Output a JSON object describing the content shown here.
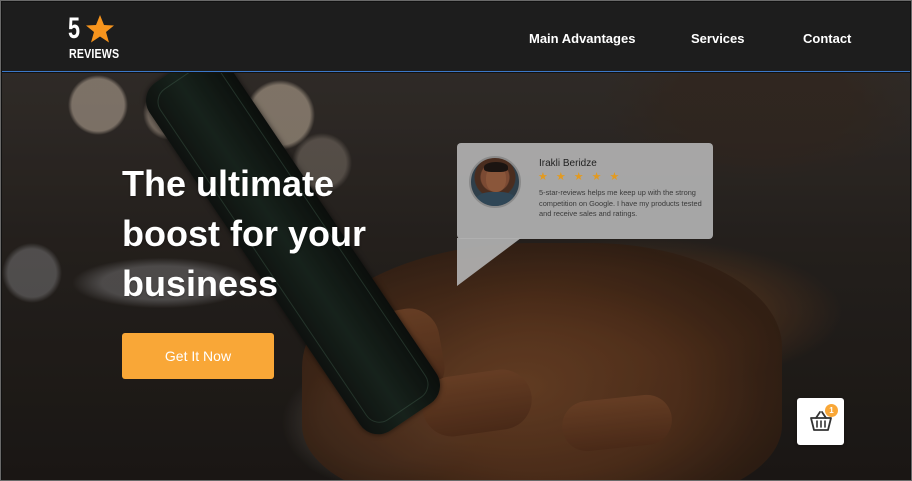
{
  "brand": {
    "logo_number": "5",
    "logo_word": "REVIEWS",
    "star_color": "#f7941d"
  },
  "nav": {
    "items": [
      {
        "label": "Main Advantages"
      },
      {
        "label": "Services"
      },
      {
        "label": "Contact"
      }
    ]
  },
  "hero": {
    "title": "The ultimate boost for your business",
    "cta_label": "Get It Now",
    "cta_color": "#f9a737"
  },
  "review": {
    "name": "Irakli Beridze",
    "rating": 5,
    "stars": [
      "★",
      "★",
      "★",
      "★",
      "★"
    ],
    "text": "5-star-reviews helps me keep up with the strong competition on Google. I have my products tested and receive sales and ratings."
  },
  "cart": {
    "icon": "basket-icon",
    "count": "1"
  }
}
